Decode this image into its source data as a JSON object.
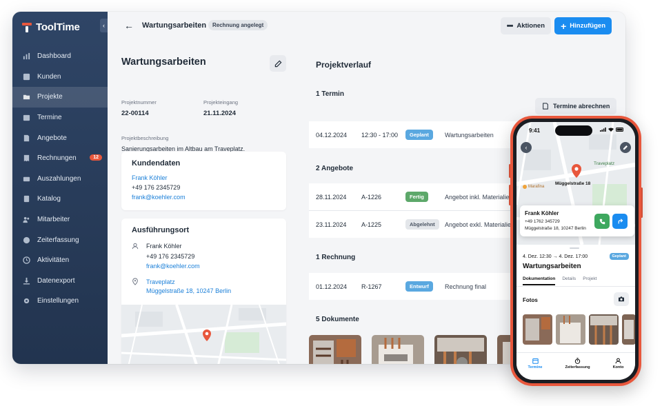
{
  "sidebar": {
    "brand": "ToolTime",
    "items": [
      {
        "label": "Dashboard",
        "icon": "chart-icon"
      },
      {
        "label": "Kunden",
        "icon": "contacts-icon"
      },
      {
        "label": "Projekte",
        "icon": "folder-icon",
        "active": true
      },
      {
        "label": "Termine",
        "icon": "calendar-icon"
      },
      {
        "label": "Angebote",
        "icon": "document-icon"
      },
      {
        "label": "Rechnungen",
        "icon": "invoice-icon",
        "badge": "12"
      },
      {
        "label": "Auszahlungen",
        "icon": "wallet-icon"
      },
      {
        "label": "Katalog",
        "icon": "book-icon"
      },
      {
        "label": "Mitarbeiter",
        "icon": "team-icon"
      },
      {
        "label": "Zeiterfassung",
        "icon": "clock-icon"
      },
      {
        "label": "Aktivitäten",
        "icon": "history-icon"
      },
      {
        "label": "Datenexport",
        "icon": "download-icon"
      },
      {
        "label": "Einstellungen",
        "icon": "settings-icon"
      }
    ]
  },
  "topbar": {
    "title": "Wartungsarbeiten",
    "status": "Rechnung angelegt",
    "actions_label": "Aktionen",
    "add_label": "Hinzufügen"
  },
  "project": {
    "title": "Wartungsarbeiten",
    "number_label": "Projektnummer",
    "number": "22-00114",
    "received_label": "Projekteingang",
    "received": "21.11.2024",
    "desc_label": "Projektbeschreibung",
    "desc": "Sanierungsarbeiten im Altbau am Traveplatz."
  },
  "customer": {
    "title": "Kundendaten",
    "name": "Frank Köhler",
    "phone": "+49 176 2345729",
    "email": "frank@koehler.com"
  },
  "location": {
    "title": "Ausführungsort",
    "contact_name": "Frank Köhler",
    "contact_phone": "+49 176 2345729",
    "contact_email": "frank@koehler.com",
    "place": "Traveplatz",
    "address": "Müggelstraße 18, 10247 Berlin"
  },
  "history": {
    "title": "Projektverlauf",
    "termine_title": "1 Termin",
    "termine_button": "Termine abrechnen",
    "termine": [
      {
        "date": "04.12.2024",
        "ref": "12:30 - 17:00",
        "status": "Geplant",
        "status_color": "#5aa8e0",
        "desc": "Wartungsarbeiten"
      }
    ],
    "angebote_title": "2 Angebote",
    "angebote": [
      {
        "date": "28.11.2024",
        "ref": "A-1226",
        "status": "Fertig",
        "status_color": "#5da86a",
        "desc": "Angebot inkl. Materialien"
      },
      {
        "date": "23.11.2024",
        "ref": "A-1225",
        "status": "Abgelehnt",
        "status_color": "#e3e6ea",
        "desc": "Angebot exkl. Materialien"
      }
    ],
    "rechnungen_title": "1 Rechnung",
    "rechnungen": [
      {
        "date": "01.12.2024",
        "ref": "R-1267",
        "status": "Entwurf",
        "status_color": "#5aa8e0",
        "desc": "Rechnung final"
      }
    ],
    "dokumente_title": "5 Dokumente"
  },
  "phone": {
    "time": "9:41",
    "map_street": "Müggelstraße 18",
    "map_place": "Traveplatz",
    "map_poi": "Marafina",
    "contact_name": "Frank Köhler",
    "contact_phone": "+49 1762 345729",
    "contact_address": "Müggelstraße 18, 10247 Berlin",
    "date_range": "4. Dez. 12:30  →  4. Dez. 17:00",
    "status": "Geplant",
    "title": "Wartungsarbeiten",
    "tabs": [
      "Dokumentation",
      "Details",
      "Projekt"
    ],
    "fotos": "Fotos",
    "tabbar": [
      "Termine",
      "Zeiterfassung",
      "Konto"
    ]
  },
  "colors": {
    "accent": "#1a8cf0",
    "brand": "#e8573c",
    "sidebar": "#2f4566"
  }
}
